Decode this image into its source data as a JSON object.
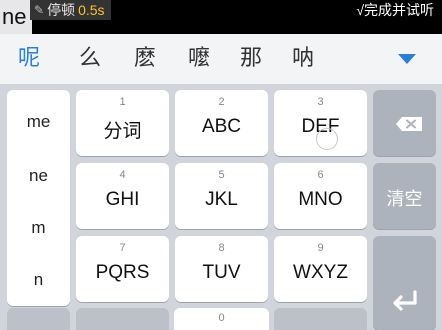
{
  "status": {
    "pinyin": "ne",
    "pause_label": "停顿",
    "pause_time": "0.5s",
    "finish_label": "√完成并试听"
  },
  "candidates": [
    "呢",
    "么",
    "麽",
    "嚒",
    "那",
    "呐"
  ],
  "pinyin_list": [
    "me",
    "ne",
    "m",
    "n"
  ],
  "keys": [
    {
      "num": "1",
      "label": "分词"
    },
    {
      "num": "2",
      "label": "ABC"
    },
    {
      "num": "3",
      "label": "DEF"
    },
    {
      "num": "4",
      "label": "GHI"
    },
    {
      "num": "5",
      "label": "JKL"
    },
    {
      "num": "6",
      "label": "MNO"
    },
    {
      "num": "7",
      "label": "PQRS"
    },
    {
      "num": "8",
      "label": "TUV"
    },
    {
      "num": "9",
      "label": "WXYZ"
    },
    {
      "num": "0"
    }
  ],
  "side_keys": {
    "clear_label": "清空"
  },
  "colors": {
    "accent": "#2a80d8",
    "pause_time": "#f4c430"
  }
}
